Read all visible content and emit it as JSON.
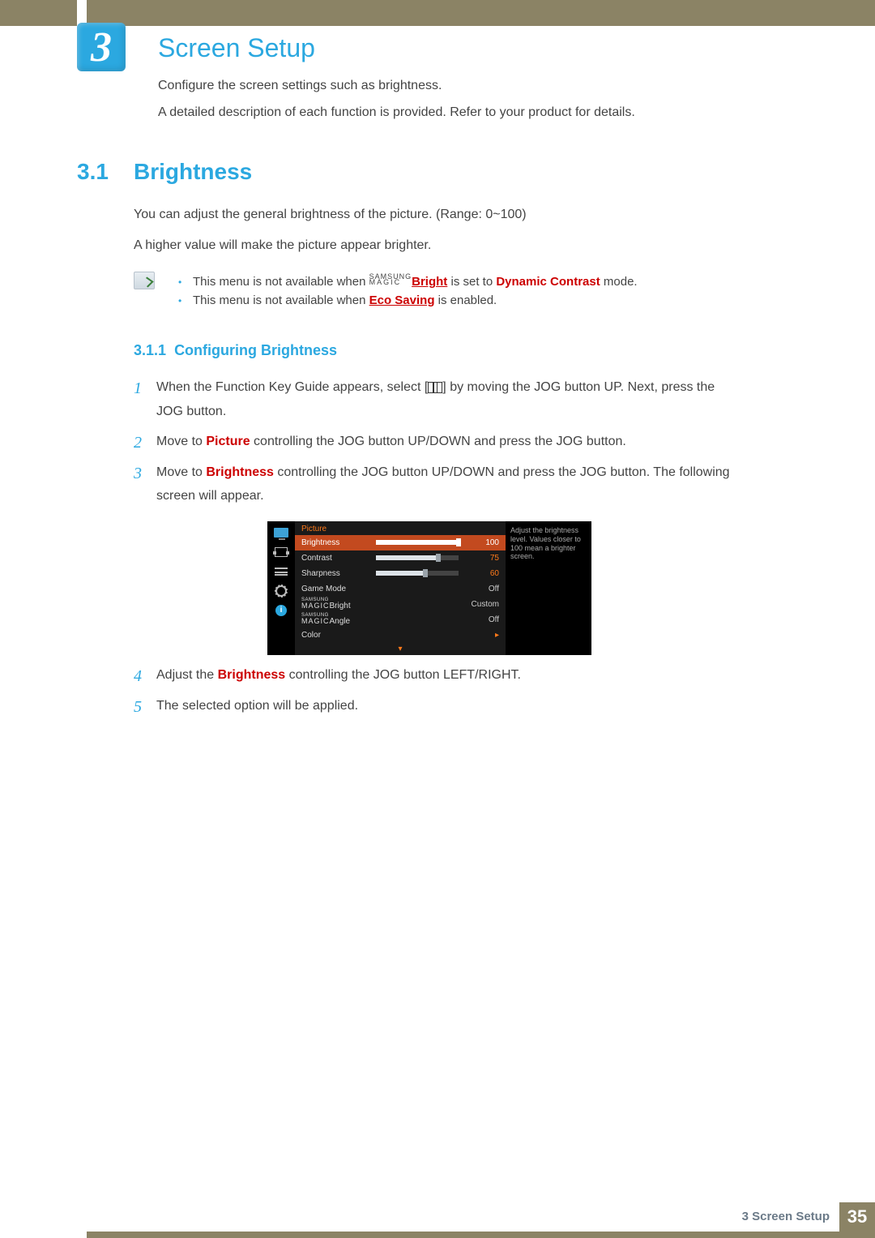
{
  "chapter": {
    "num": "3",
    "title": "Screen Setup"
  },
  "intro": {
    "l1": "Configure the screen settings such as brightness.",
    "l2": "A detailed description of each function is provided. Refer to your product for details."
  },
  "section": {
    "num": "3.1",
    "title": "Brightness"
  },
  "body": {
    "p1": "You can adjust the general brightness of the picture. (Range: 0~100)",
    "p2": "A higher value will make the picture appear brighter."
  },
  "notes": {
    "n1_a": "This menu is not available when ",
    "n1_magic_top": "SAMSUNG",
    "n1_magic_bot": "MAGIC",
    "n1_bright": "Bright",
    "n1_b": " is set to ",
    "n1_dc": "Dynamic Contrast",
    "n1_c": " mode.",
    "n2_a": "This menu is not available when ",
    "n2_eco": "Eco Saving",
    "n2_b": " is enabled."
  },
  "subsection": {
    "num": "3.1.1",
    "title": "Configuring Brightness"
  },
  "steps": {
    "s1a": "When the Function Key Guide appears, select [",
    "s1b": "] by moving the JOG button UP. Next, press the JOG button.",
    "s2a": "Move to ",
    "s2_pic": "Picture",
    "s2b": " controlling the JOG button UP/DOWN and press the JOG button.",
    "s3a": "Move to ",
    "s3_bri": "Brightness",
    "s3b": " controlling the JOG button UP/DOWN and press the JOG button. The following screen will appear.",
    "s4a": "Adjust the ",
    "s4_bri": "Brightness",
    "s4b": " controlling the JOG button LEFT/RIGHT.",
    "s5": "The selected option will be applied."
  },
  "osd": {
    "header": "Picture",
    "desc": "Adjust the brightness level. Values closer to 100 mean a brighter screen.",
    "rows": [
      {
        "label": "Brightness",
        "value": "100",
        "pct": 100,
        "selected": true,
        "type": "slider"
      },
      {
        "label": "Contrast",
        "value": "75",
        "pct": 75,
        "selected": false,
        "type": "slider"
      },
      {
        "label": "Sharpness",
        "value": "60",
        "pct": 60,
        "selected": false,
        "type": "slider"
      },
      {
        "label": "Game Mode",
        "valtxt": "Off",
        "type": "text"
      },
      {
        "label_top": "SAMSUNG",
        "label_bot": "MAGIC",
        "label_suffix": "Bright",
        "valtxt": "Custom",
        "type": "magic"
      },
      {
        "label_top": "SAMSUNG",
        "label_bot": "MAGIC",
        "label_suffix": "Angle",
        "valtxt": "Off",
        "type": "magic"
      },
      {
        "label": "Color",
        "type": "arrow"
      }
    ],
    "down_arrow": "▾",
    "right_arrow": "▸",
    "info_i": "i"
  },
  "footer": {
    "breadcrumb": "3 Screen Setup",
    "page": "35"
  }
}
